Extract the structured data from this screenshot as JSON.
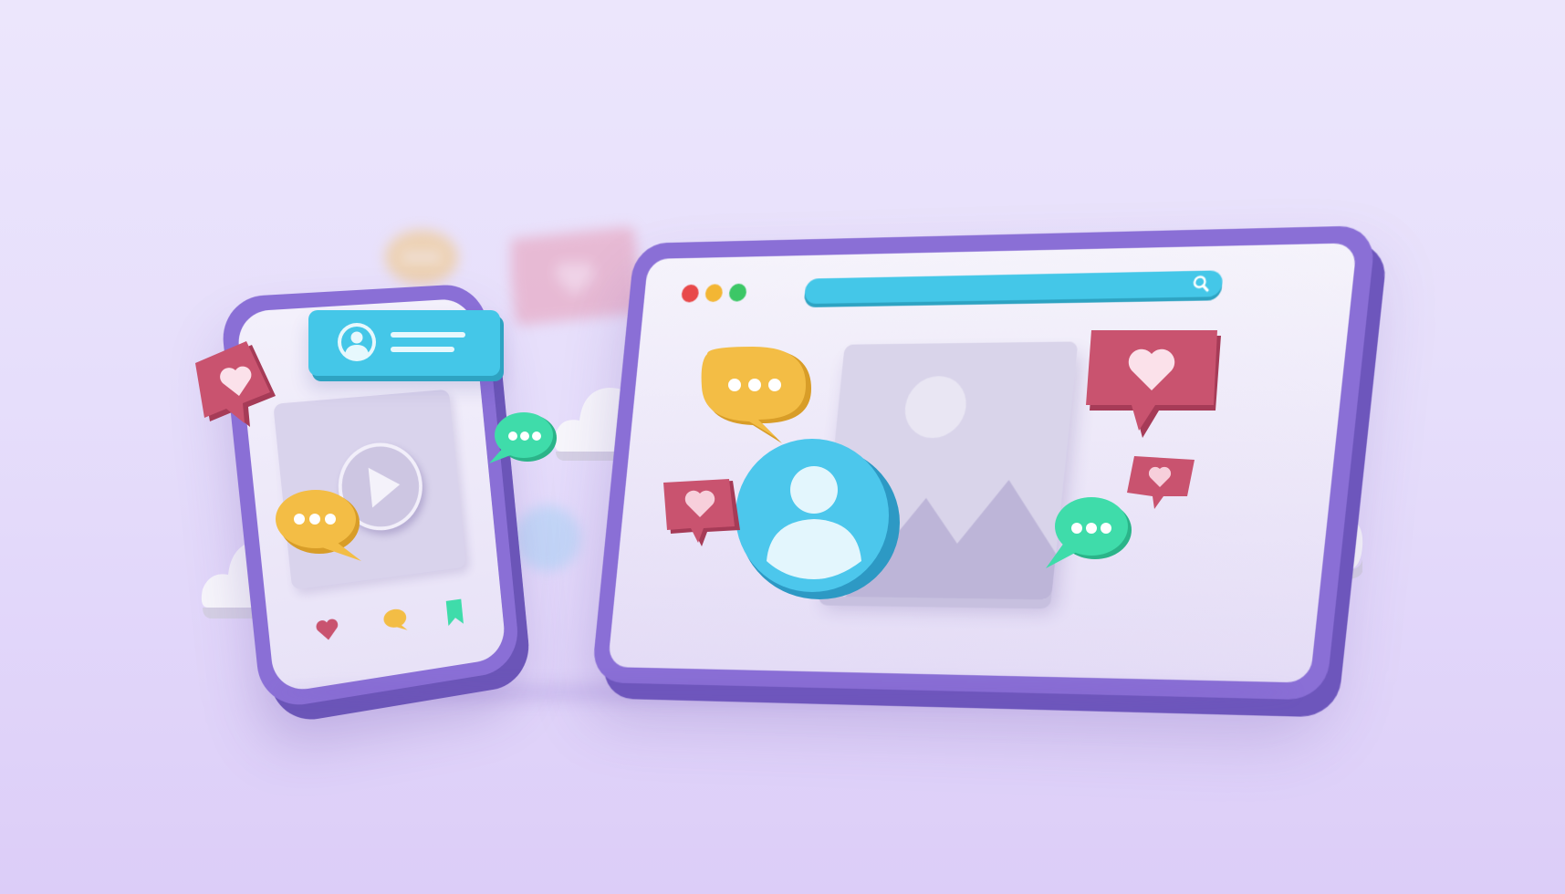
{
  "scene": {
    "colors": {
      "device_purple": "#8a6fd6",
      "accent_blue": "#44c7e8",
      "heart_red": "#c7536e",
      "chat_yellow": "#f3bd45",
      "chat_green": "#3fdcaa"
    },
    "phone": {
      "profile_card_icon": "user-icon",
      "video_icon": "play-icon",
      "actions": [
        "heart-icon",
        "comment-icon",
        "bookmark-icon"
      ]
    },
    "tablet": {
      "window_controls": [
        "close-dot",
        "minimize-dot",
        "maximize-dot"
      ],
      "search_icon": "search-icon",
      "content_icon": "image-icon",
      "avatar_icon": "user-icon"
    },
    "floating_icons": [
      "heart-bubble-icon",
      "chat-bubble-icon",
      "cloud-icon"
    ]
  }
}
